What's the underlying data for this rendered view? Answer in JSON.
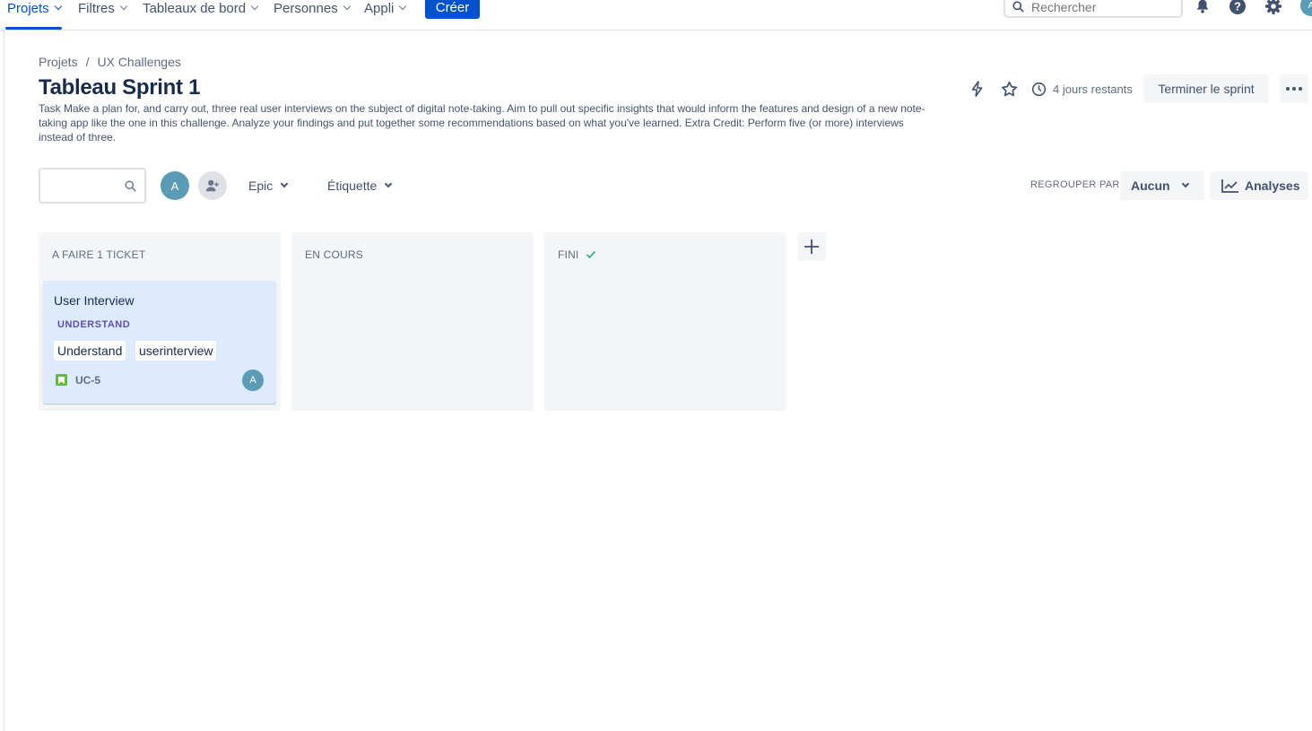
{
  "topnav": {
    "items": [
      {
        "label": "Projets",
        "active": true
      },
      {
        "label": "Filtres"
      },
      {
        "label": "Tableaux de bord"
      },
      {
        "label": "Personnes"
      },
      {
        "label": "Appli"
      }
    ],
    "create_label": "Créer",
    "search_placeholder": "Rechercher",
    "icons": [
      "notifications-icon",
      "help-icon",
      "settings-icon",
      "profile-avatar"
    ]
  },
  "breadcrumb": {
    "root": "Projets",
    "separator": "/",
    "project": "UX Challenges"
  },
  "page": {
    "title": "Tableau Sprint 1",
    "sprint_goal": "Task Make a plan for, and carry out, three real user interviews on the subject of digital note-taking. Aim to pull out specific insights that would inform the features and design of a new note-taking app like the one in this challenge. Analyze your findings and put together some recommendations based on what you've learned. Extra Credit: Perform five (or more) interviews instead of three."
  },
  "header_actions": {
    "days_left": "4 jours restants",
    "end_sprint_label": "Terminer le sprint"
  },
  "toolbar": {
    "avatar_initial": "A",
    "epic_label": "Epic",
    "label_filter": "Étiquette",
    "group_by_label": "REGROUPER PAR",
    "group_by_value": "Aucun",
    "insights_label": "Analyses"
  },
  "columns": [
    {
      "title": "A FAIRE 1 TICKET"
    },
    {
      "title": "EN COURS"
    },
    {
      "title": "FINI"
    }
  ],
  "card": {
    "title": "User Interview",
    "epic": "UNDERSTAND",
    "labels": [
      "Understand",
      "userinterview"
    ],
    "key": "UC-5",
    "assignee_initial": "A"
  },
  "colors": {
    "brand": "#0052cc",
    "card_bg": "#deebff",
    "epic_text": "#5e4db2",
    "story_icon": "#63ba3c",
    "done_check": "#36b37e",
    "avatar": "#5b9bb5"
  }
}
